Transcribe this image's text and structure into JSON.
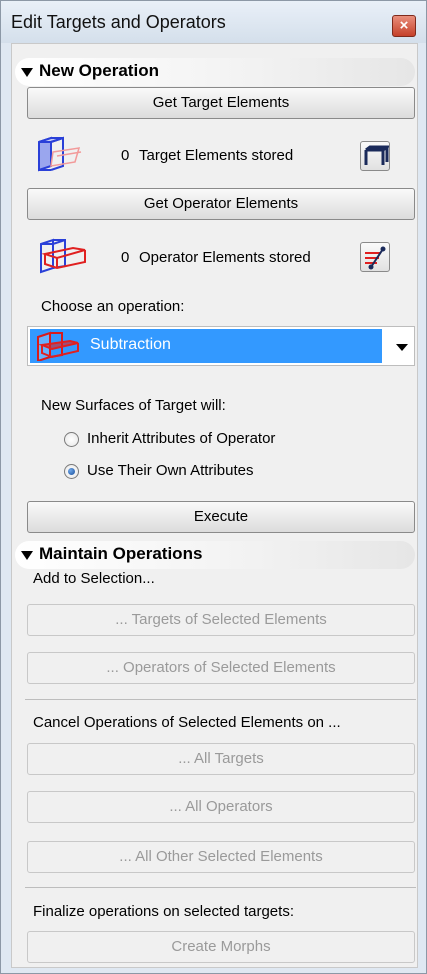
{
  "window": {
    "title": "Edit Targets and Operators",
    "close_glyph": "×"
  },
  "new_operation": {
    "header": "New Operation",
    "get_target_button": "Get Target Elements",
    "target_count": "0",
    "target_label": "Target Elements stored",
    "get_operator_button": "Get Operator Elements",
    "operator_count": "0",
    "operator_label": "Operator Elements stored",
    "choose_label": "Choose an operation:",
    "operation_selected": "Subtraction",
    "surfaces_label": "New Surfaces of Target will:",
    "radio_inherit": "Inherit Attributes of Operator",
    "radio_own": "Use Their Own Attributes",
    "radio_selected": "own",
    "execute_button": "Execute"
  },
  "maintain": {
    "header": "Maintain Operations",
    "add_label": "Add to Selection...",
    "targets_button": "... Targets of Selected Elements",
    "operators_button": "... Operators of Selected Elements",
    "cancel_label": "Cancel Operations of Selected Elements on ...",
    "all_targets_button": "... All Targets",
    "all_operators_button": "... All Operators",
    "all_other_button": "... All Other Selected Elements",
    "finalize_label": "Finalize operations on selected targets:",
    "create_morphs_button": "Create Morphs"
  },
  "colors": {
    "selection": "#3399ff",
    "target_icon": "#2a40d8",
    "operator_icon": "#e02020"
  }
}
